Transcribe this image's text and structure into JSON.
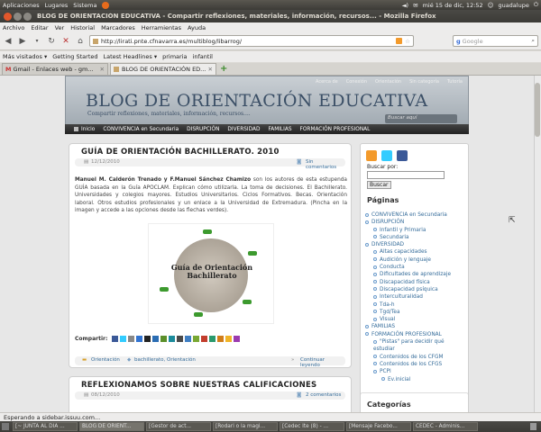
{
  "gnome_panel": {
    "menus": [
      "Aplicaciones",
      "Lugares",
      "Sistema"
    ],
    "clock": "mié 15 de dic, 12:52",
    "user": "guadalupe"
  },
  "window": {
    "title": "BLOG DE ORIENTACIÓN EDUCATIVA - Compartir reflexiones, materiales, información, recursos... - Mozilla Firefox"
  },
  "menubar": [
    "Archivo",
    "Editar",
    "Ver",
    "Historial",
    "Marcadores",
    "Herramientas",
    "Ayuda"
  ],
  "navbar": {
    "url": "http://lirati.pnte.cfnavarra.es/multiblog/libarrog/",
    "search_placeholder": "Google"
  },
  "bookmarks": [
    "Más visitados ▾",
    "Getting Started",
    "Latest Headlines ▾",
    "primaria",
    "infantil"
  ],
  "tabs": [
    {
      "label": "Gmail - Enlaces web - gm...",
      "active": false
    },
    {
      "label": "BLOG DE ORIENTACIÓN ED...",
      "active": true
    }
  ],
  "blog": {
    "toplinks": [
      "Acerca de",
      "Conexión",
      "Orientación",
      "Sin categoría",
      "Tutoría"
    ],
    "title": "BLOG DE ORIENTACIÓN EDUCATIVA",
    "subtitle": "Compartir reflexiones, materiales, información, recursos....",
    "search_placeholder": "Buscar aquí",
    "nav": [
      "Inicio",
      "CONVIVENCIA en Secundaria",
      "DISRUPCIÓN",
      "DIVERSIDAD",
      "FAMILIAS",
      "FORMACIÓN PROFESIONAL"
    ]
  },
  "post1": {
    "title": "GUÍA DE ORIENTACIÓN BACHILLERATO. 2010",
    "date": "12/12/2010",
    "comments": "Sin comentarios",
    "author_strong": "Manuel M. Calderón Trenado y F.Manuel Sánchez Chamizo",
    "body": " son los autores de esta estupenda GUÍA basada en la Guía APOCLAM.  Explican cómo utilizarla.  La toma de decisiones.  El Bachillerato. Universidades y colegios mayores.  Estudios Universitarios.  Ciclos Formativos. Becas. Orientación laboral. Otros estudios profesionales y un enlace a la Universidad de Extremadura.  (Pincha en la imagen y accede a las opciones desde las flechas verdes).",
    "image_title": "Guía de Orientación Bachillerato",
    "share_label": "Compartir:",
    "category": "Orientación",
    "tags": "bachillerato, Orientación",
    "continue": "Continuar leyendo"
  },
  "post2": {
    "title": "REFLEXIONAMOS SOBRE NUESTRAS CALIFICACIONES",
    "date": "08/12/2010",
    "comments": "2 comentarios"
  },
  "sidebar": {
    "search_label": "Buscar por:",
    "search_button": "Buscar",
    "pages_heading": "Páginas",
    "categories_heading": "Categorías",
    "pages": [
      {
        "label": "CONVIVENCIA en Secundaria",
        "level": 0
      },
      {
        "label": "DISRUPCIÓN",
        "level": 0
      },
      {
        "label": "Infantil y Primaria",
        "level": 1
      },
      {
        "label": "Secundaria",
        "level": 1
      },
      {
        "label": "DIVERSIDAD",
        "level": 0
      },
      {
        "label": "Altas capacidades",
        "level": 1
      },
      {
        "label": "Audición y lenguaje",
        "level": 1
      },
      {
        "label": "Conducta",
        "level": 1
      },
      {
        "label": "Dificultades de aprendizaje",
        "level": 1
      },
      {
        "label": "Discapacidad física",
        "level": 1
      },
      {
        "label": "Discapacidad psíquica",
        "level": 1
      },
      {
        "label": "Interculturalidad",
        "level": 1
      },
      {
        "label": "Tda-h",
        "level": 1
      },
      {
        "label": "Tgd/Tea",
        "level": 1
      },
      {
        "label": "Visual",
        "level": 1
      },
      {
        "label": "FAMILIAS",
        "level": 0
      },
      {
        "label": "FORMACIÓN PROFESIONAL",
        "level": 0
      },
      {
        "label": "\"Pistas\" para decidir qué estudiar",
        "level": 1
      },
      {
        "label": "Contenidos de los CFGM",
        "level": 1
      },
      {
        "label": "Contenidos de los CFGS",
        "level": 1
      },
      {
        "label": "PCPI",
        "level": 1
      },
      {
        "label": "Ev.inicial",
        "level": 2
      }
    ]
  },
  "statusbar": "Esperando a sidebar.issuu.com...",
  "taskbar": [
    "[~ JUNTA AL DÍA ...",
    "BLOG DE ORIENT...",
    "[Gestor de act...",
    "[Rodari o la magi...",
    "[Cedec Ite (8) - ...",
    "[Mensaje Facebo...",
    "CEDEC - Adminis..."
  ]
}
